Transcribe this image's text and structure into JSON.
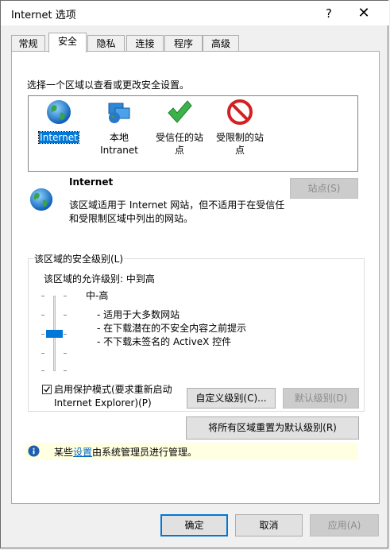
{
  "window": {
    "title": "Internet 选项",
    "help_label": "?",
    "close_label": "✕"
  },
  "tabs": [
    {
      "label": "常规"
    },
    {
      "label": "安全"
    },
    {
      "label": "隐私"
    },
    {
      "label": "连接"
    },
    {
      "label": "程序"
    },
    {
      "label": "高级"
    }
  ],
  "security": {
    "select_zone_prompt": "选择一个区域以查看或更改安全设置。",
    "zones": [
      {
        "label": "Internet",
        "icon": "globe-icon"
      },
      {
        "label": "本地\nIntranet",
        "icon": "intranet-icon"
      },
      {
        "label": "受信任的站\n点",
        "icon": "trusted-check-icon"
      },
      {
        "label": "受限制的站\n点",
        "icon": "restricted-icon"
      }
    ],
    "selected_zone_name": "Internet",
    "zone_description": "该区域适用于 Internet 网站，但不适用于在受信任和受限制区域中列出的网站。",
    "sites_button": "站点(S)",
    "level_group_label": "该区域的安全级别(L)",
    "allowed_levels": "该区域的允许级别: 中到高",
    "level_name": "中-高",
    "level_points": [
      "- 适用于大多数网站",
      "- 在下载潜在的不安全内容之前提示",
      "- 不下载未签名的 ActiveX 控件"
    ],
    "level_slider_position": 0.5,
    "protected_mode_label": "启用保护模式(要求重新启动 Internet Explorer)(P)",
    "protected_mode_checked": true,
    "custom_level_button": "自定义级别(C)...",
    "default_level_button": "默认级别(D)",
    "reset_all_button": "将所有区域重置为默认级别(R)",
    "info_prefix": "某些",
    "info_link": "设置",
    "info_suffix": "由系统管理员进行管理。"
  },
  "footer": {
    "ok": "确定",
    "cancel": "取消",
    "apply": "应用(A)"
  }
}
